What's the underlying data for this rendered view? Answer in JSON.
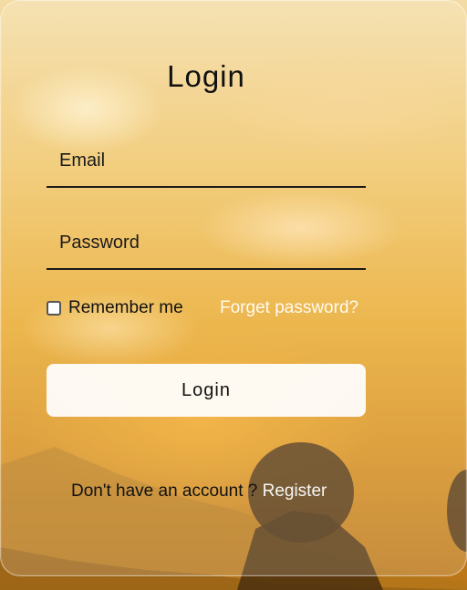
{
  "login_form": {
    "title": "Login",
    "email": {
      "placeholder": "Email",
      "value": ""
    },
    "password": {
      "placeholder": "Password",
      "value": ""
    },
    "remember_me": {
      "label": "Remember me",
      "checked": false
    },
    "forget_password_label": "Forget password?",
    "submit_label": "Login",
    "register_prompt": "Don't have an account ?",
    "register_link_label": "Register"
  },
  "colors": {
    "accent_text": "#ffffff",
    "background_tone": "#e9a92c"
  }
}
